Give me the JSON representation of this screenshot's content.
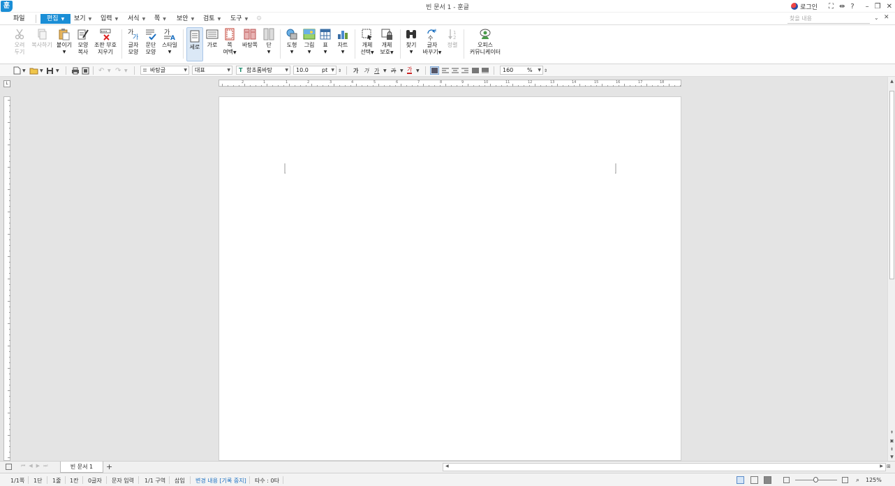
{
  "window": {
    "title": "빈 문서 1 - 훈글",
    "logo": "훈",
    "login_label": "로그인"
  },
  "menu": {
    "items": [
      {
        "label": "파일"
      },
      {
        "label": "편집"
      },
      {
        "label": "보기"
      },
      {
        "label": "입력"
      },
      {
        "label": "서식"
      },
      {
        "label": "쪽"
      },
      {
        "label": "보안"
      },
      {
        "label": "검토"
      },
      {
        "label": "도구"
      }
    ],
    "active": "편집",
    "search_placeholder": "찾을 내용"
  },
  "ribbon": {
    "cut": [
      "오려",
      "두기"
    ],
    "copy": [
      "복사하기"
    ],
    "paste": [
      "붙이기"
    ],
    "format_copy": [
      "모양",
      "복사"
    ],
    "clear_format": [
      "조판 부호",
      "지우기"
    ],
    "char_shape": [
      "글자",
      "모양"
    ],
    "para_shape": [
      "문단",
      "모양"
    ],
    "style": [
      "스타일"
    ],
    "portrait": [
      "세로"
    ],
    "landscape": [
      "가로"
    ],
    "margin": [
      "쪽",
      "여백"
    ],
    "background": [
      "바탕쪽"
    ],
    "column": [
      "단"
    ],
    "shape": [
      "도형"
    ],
    "picture": [
      "그림"
    ],
    "table": [
      "표"
    ],
    "chart": [
      "차트"
    ],
    "select_obj": [
      "개체",
      "선택"
    ],
    "protect_obj": [
      "개체",
      "보호"
    ],
    "find": [
      "찾기"
    ],
    "replace": [
      "글자",
      "바꾸기"
    ],
    "sort": [
      "정렬"
    ],
    "office_comm": [
      "오피스",
      "커뮤니케이터"
    ]
  },
  "format": {
    "style_name": "바탕글",
    "language": "대표",
    "font": "함초롬바탕",
    "font_size": "10.0",
    "size_unit": "pt",
    "bold_glyph": "가",
    "italic_glyph": "가",
    "underline_glyph": "가",
    "strike_glyph": "가",
    "color_glyph": "가",
    "line_spacing": "160",
    "line_spacing_unit": "%"
  },
  "ruler_numbers": [
    "2",
    "1",
    "1",
    "2",
    "3",
    "4",
    "5",
    "6",
    "7",
    "8",
    "9",
    "10",
    "11",
    "12",
    "13",
    "14",
    "15",
    "16",
    "17",
    "18"
  ],
  "tabs": {
    "doc_tab": "빈 문서 1",
    "add": "+"
  },
  "status": {
    "page": "1/1쪽",
    "column": "1단",
    "line": "1줄",
    "col_pos": "1칸",
    "chars": "0글자",
    "input_mode": "문자 입력",
    "section": "1/1 구역",
    "insert": "삽입",
    "track": "변경 내용 [기록 중지]",
    "keystroke": "타수 : 0타",
    "zoom": "125%"
  },
  "colors": {
    "accent": "#1a8ed6",
    "page": "#ffffff",
    "workspace": "#e4e4e4"
  }
}
